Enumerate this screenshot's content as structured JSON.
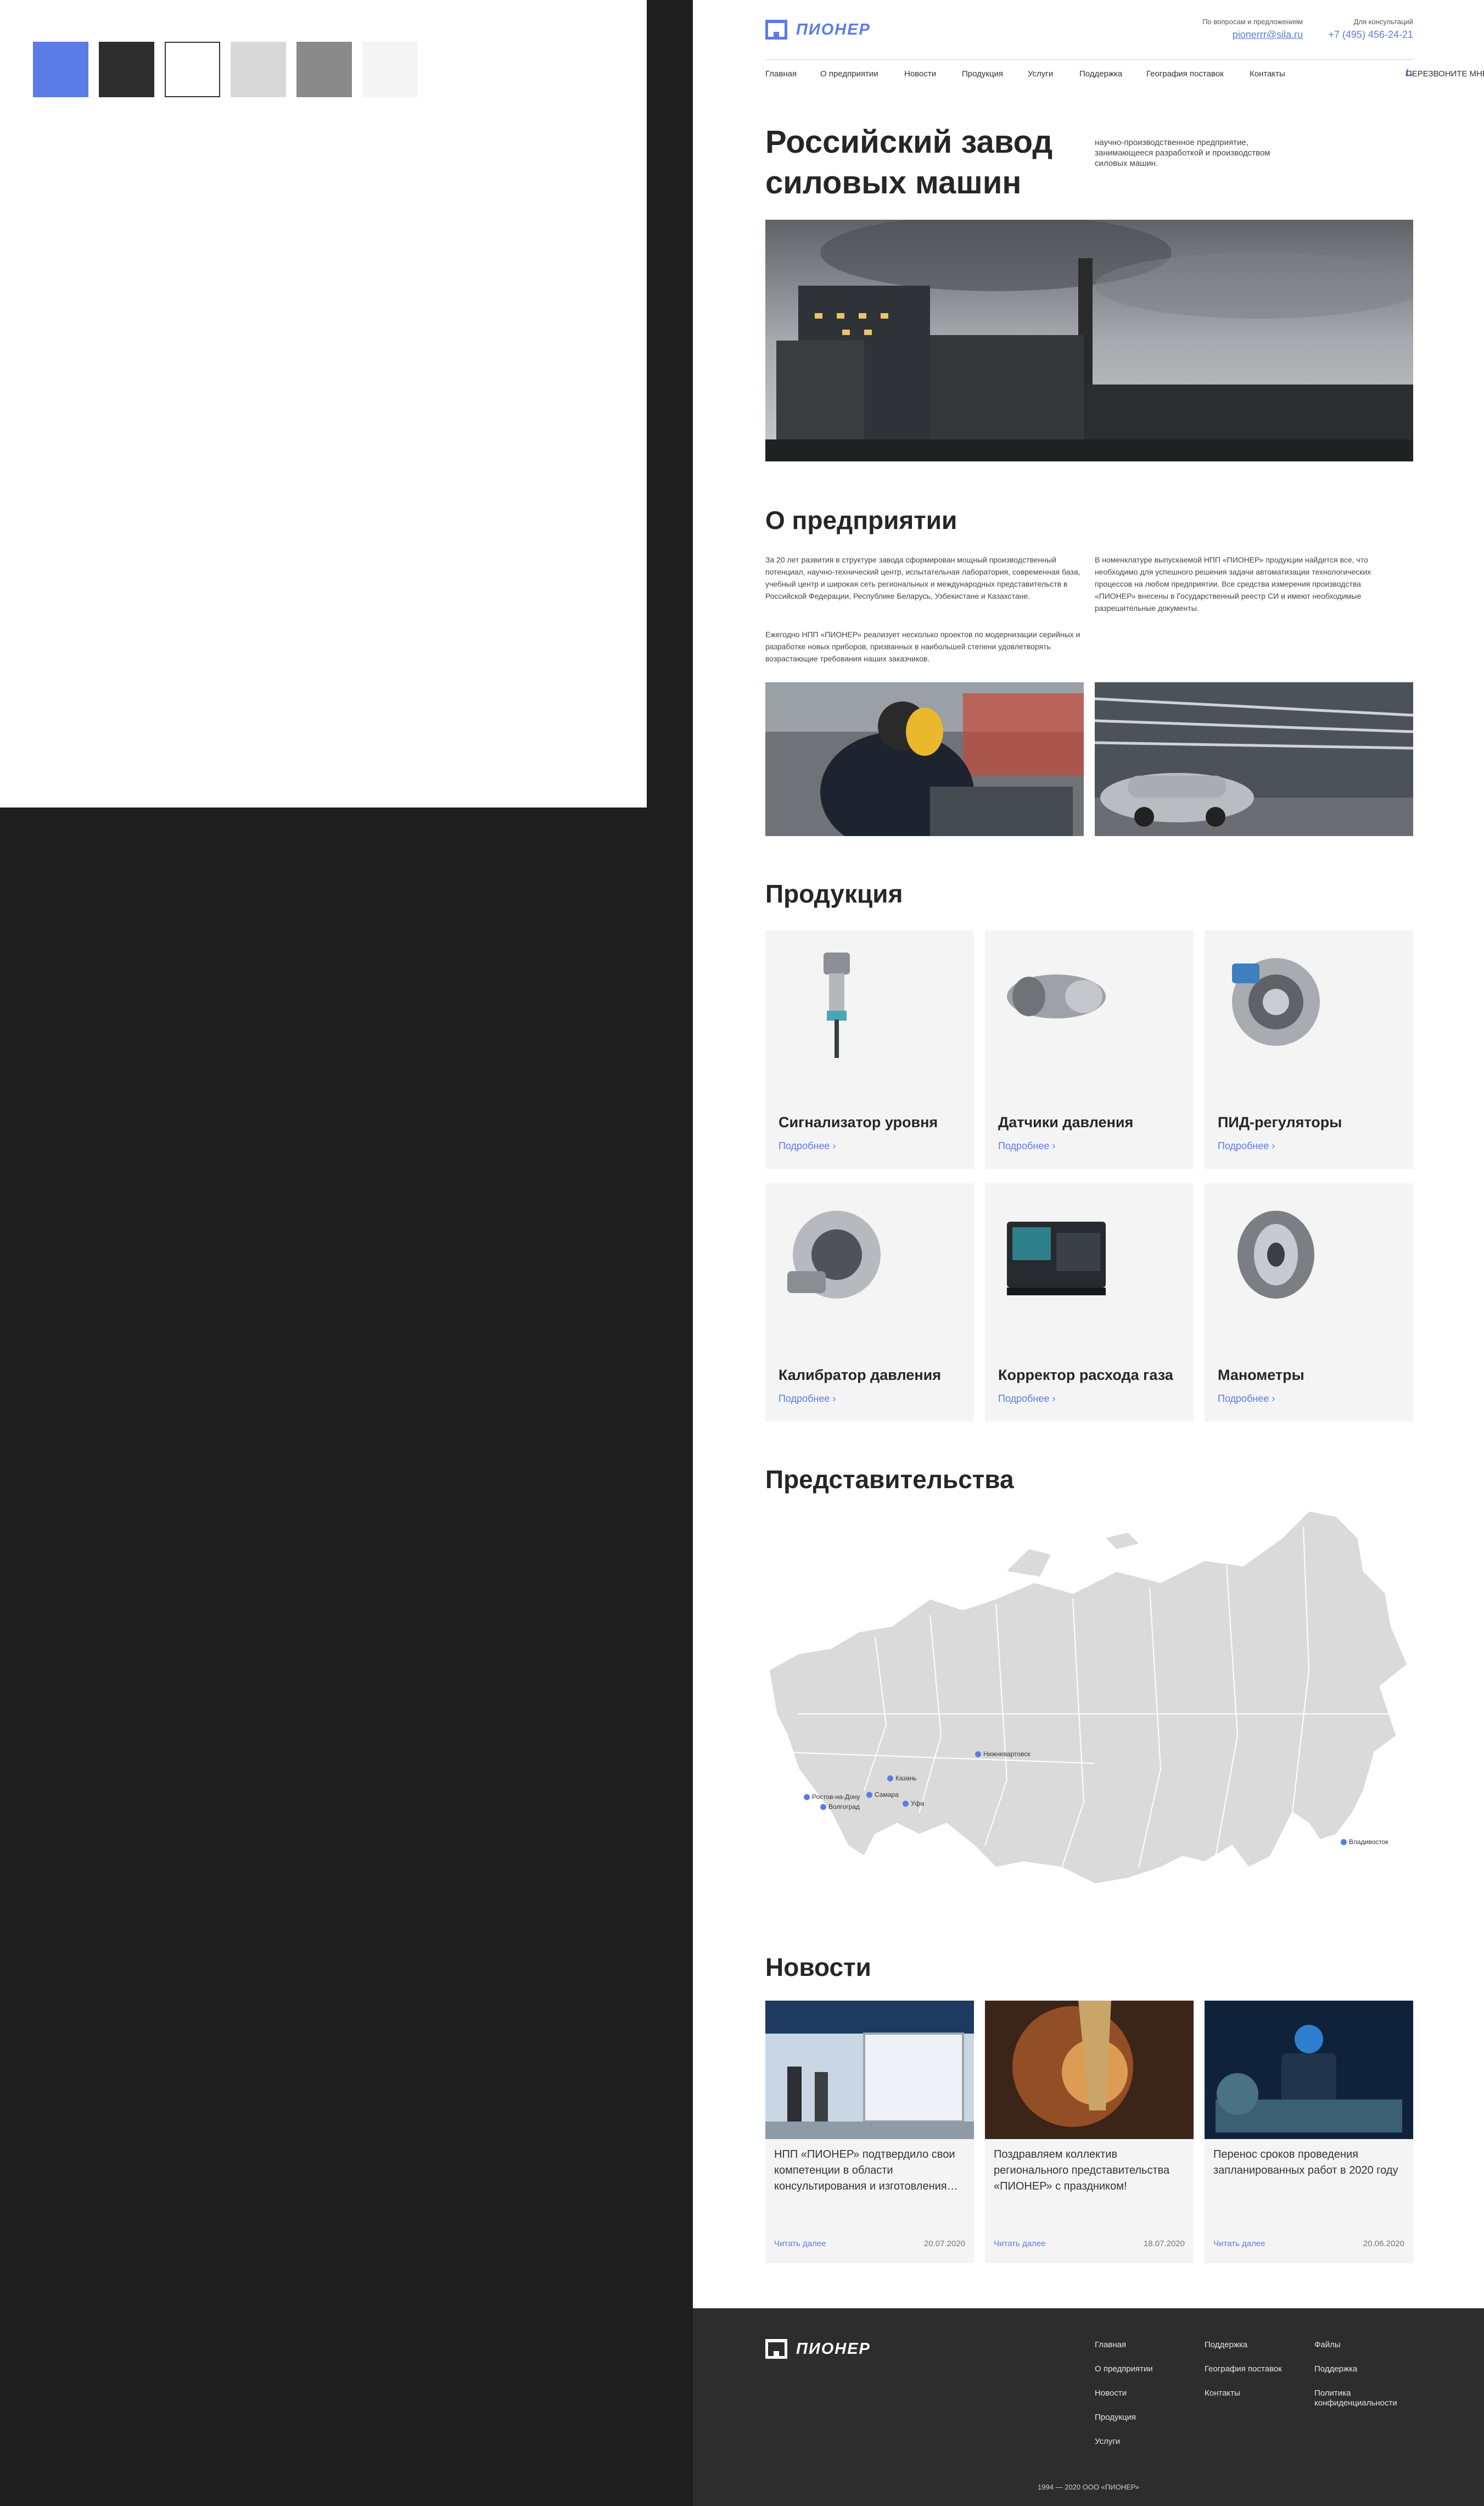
{
  "palette": [
    "#5b7be6",
    "#2d2d2d",
    "#ffffff",
    "#d9d9d9",
    "#8a8a8a",
    "#f4f4f4"
  ],
  "header": {
    "logo": "ПИОНЕР",
    "email_caption": "По вопросам и предложениям",
    "email": "pionerrr@sila.ru",
    "phone_caption": "Для консультаций",
    "phone": "+7 (495) 456-24-21",
    "nav": [
      "Главная",
      "О предприятии",
      "Новости",
      "Продукция",
      "Услуги",
      "Поддержка",
      "География поставок",
      "Контакты"
    ],
    "callback": "ПЕРЕЗВОНИТЕ МНЕ"
  },
  "hero": {
    "title": "Российский завод силовых машин",
    "subtitle": "научно-производственное предприятие, занимающееся разработкой и производством силовых машин."
  },
  "about": {
    "title": "О предприятии",
    "p1": "За 20 лет развития в структуре завода сформирован мощный производственный потенциал, научно-технический центр, испытательная лаборатория, современная база, учебный центр и широкая сеть региональных и международных представительств в Российской Федерации, Республике Беларусь, Узбекистане и Казахстане.",
    "p2": "Ежегодно НПП «ПИОНЕР» реализует несколько проектов по модернизации серийных и разработке новых приборов, призванных в наибольшей степени удовлетворять возрастающие требования наших заказчиков.",
    "p3": "В номенклатуре выпускаемой НПП «ПИОНЕР» продукции найдется все, что необходимо для успешного решения задачи автоматизации технологических процессов на любом предприятии. Все средства измерения производства «ПИОНЕР» внесены в Государственный реестр СИ и имеют необходимые разрешительные документы."
  },
  "products": {
    "title": "Продукция",
    "more": "Подробнее",
    "items": [
      {
        "name": "Сигнализатор уровня"
      },
      {
        "name": "Датчики давления"
      },
      {
        "name": "ПИД-регуляторы"
      },
      {
        "name": "Калибратор давления"
      },
      {
        "name": "Корректор расхода газа"
      },
      {
        "name": "Манометры"
      }
    ]
  },
  "offices": {
    "title": "Представительства",
    "cities": [
      "Нижневартовск",
      "Казань",
      "Самара",
      "Уфа",
      "Ростов-на-Дону",
      "Волгоград",
      "Владивосток"
    ]
  },
  "news": {
    "title": "Новости",
    "more": "Читать далее",
    "items": [
      {
        "text": "НПП «ПИОНЕР» подтвердило свои компетенции в области консультирования и изготовления…",
        "date": "20.07.2020"
      },
      {
        "text": "Поздравляем коллектив регионального представительства «ПИОНЕР» с праздником!",
        "date": "18.07.2020"
      },
      {
        "text": "Перенос сроков проведения запланированных работ в 2020 году",
        "date": "20.06.2020"
      }
    ]
  },
  "footer": {
    "logo": "ПИОНЕР",
    "col1": [
      "Главная",
      "О предприятии",
      "Новости",
      "Продукция",
      "Услуги"
    ],
    "col2": [
      "Поддержка",
      "География поставок",
      "Контакты"
    ],
    "col3": [
      "Файлы",
      "Поддержка",
      "Политика конфиденциальности"
    ],
    "copyright": "1994 — 2020 ООО «ПИОНЕР»"
  }
}
